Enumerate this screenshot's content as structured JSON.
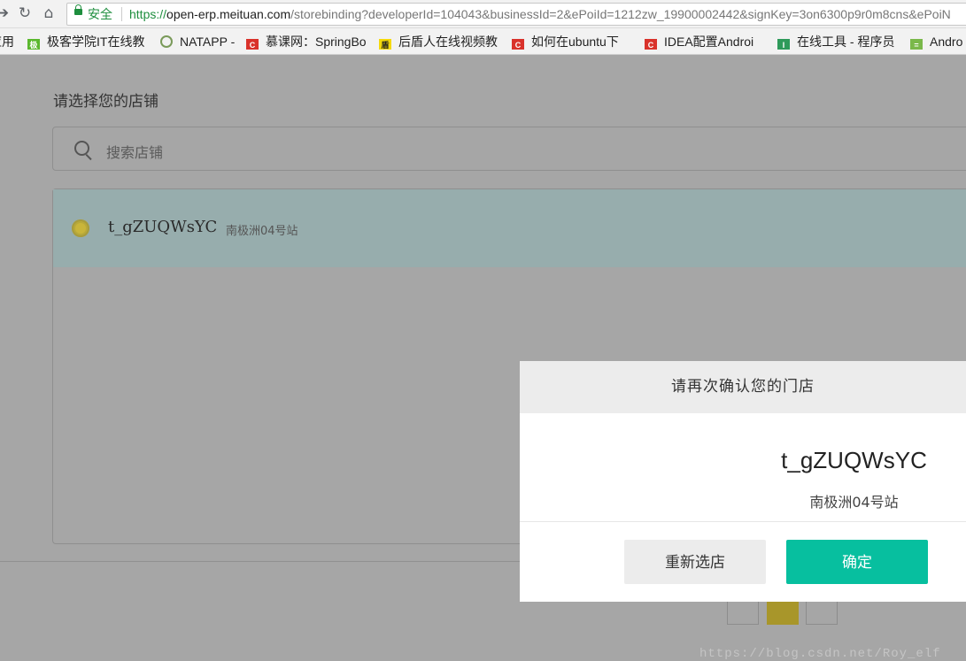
{
  "browser": {
    "secure_label": "安全",
    "url_proto": "https://",
    "url_host": "open-erp.meituan.com",
    "url_path": "/storebinding?developerId=104043&businessId=2&ePoiId=1212zw_19900002442&signKey=3on6300p9r0m8cns&ePoiN"
  },
  "bookmarks": [
    {
      "label": "应用",
      "icon": "apps-icon",
      "color": ""
    },
    {
      "label": "极客学院IT在线教",
      "icon": "jikexueyuan-icon",
      "color": "#5bb82e"
    },
    {
      "label": "NATAPP -",
      "icon": "natapp-icon",
      "color": "#7a9a5a"
    },
    {
      "label": "慕课网：SpringBo",
      "icon": "imooc-icon",
      "color": "#d9322b"
    },
    {
      "label": "后盾人在线视频教",
      "icon": "houdunren-icon",
      "color": "#f5d90a"
    },
    {
      "label": "如何在ubuntu下",
      "icon": "csdn-icon",
      "color": "#d9322b"
    },
    {
      "label": "IDEA配置Androi",
      "icon": "csdn-icon",
      "color": "#d9322b"
    },
    {
      "label": "在线工具 - 程序员",
      "icon": "tool-icon",
      "color": "#2e9a5a"
    },
    {
      "label": "Andro",
      "icon": "android-icon",
      "color": "#7ab84a"
    }
  ],
  "page": {
    "title": "请选择您的店铺",
    "search_placeholder": "搜索店铺"
  },
  "stores": [
    {
      "name": "t_gZUQWsYC",
      "address": "南极洲04号站",
      "selected": true
    }
  ],
  "dialog": {
    "title": "请再次确认您的门店",
    "store_name": "t_gZUQWsYC",
    "store_address": "南极洲04号站",
    "reselect_label": "重新选店",
    "confirm_label": "确定"
  },
  "watermark": "https://blog.csdn.net/Roy_elf",
  "colors": {
    "primary": "#07bf9f",
    "overlay_bg": "#a6a6a6",
    "selected_row": "#97adad"
  }
}
